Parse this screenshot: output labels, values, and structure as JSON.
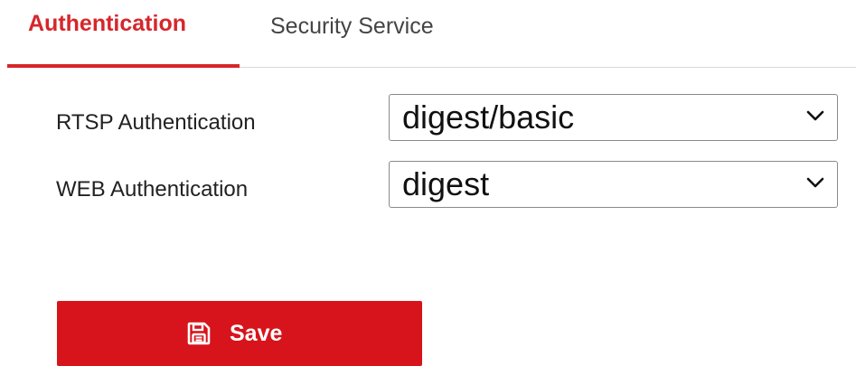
{
  "tabs": [
    {
      "label": "Authentication",
      "active": true
    },
    {
      "label": "Security Service",
      "active": false
    }
  ],
  "form": {
    "rtsp": {
      "label": "RTSP Authentication",
      "value": "digest/basic",
      "icon": "chevron-down-icon"
    },
    "web": {
      "label": "WEB Authentication",
      "value": "digest",
      "icon": "chevron-down-icon"
    }
  },
  "actions": {
    "save_label": "Save",
    "save_icon": "floppy-disk-icon"
  },
  "colors": {
    "accent": "#d6262b",
    "save_button": "#d7141b",
    "tab_inactive": "#444444",
    "border": "#8a8a8a"
  }
}
